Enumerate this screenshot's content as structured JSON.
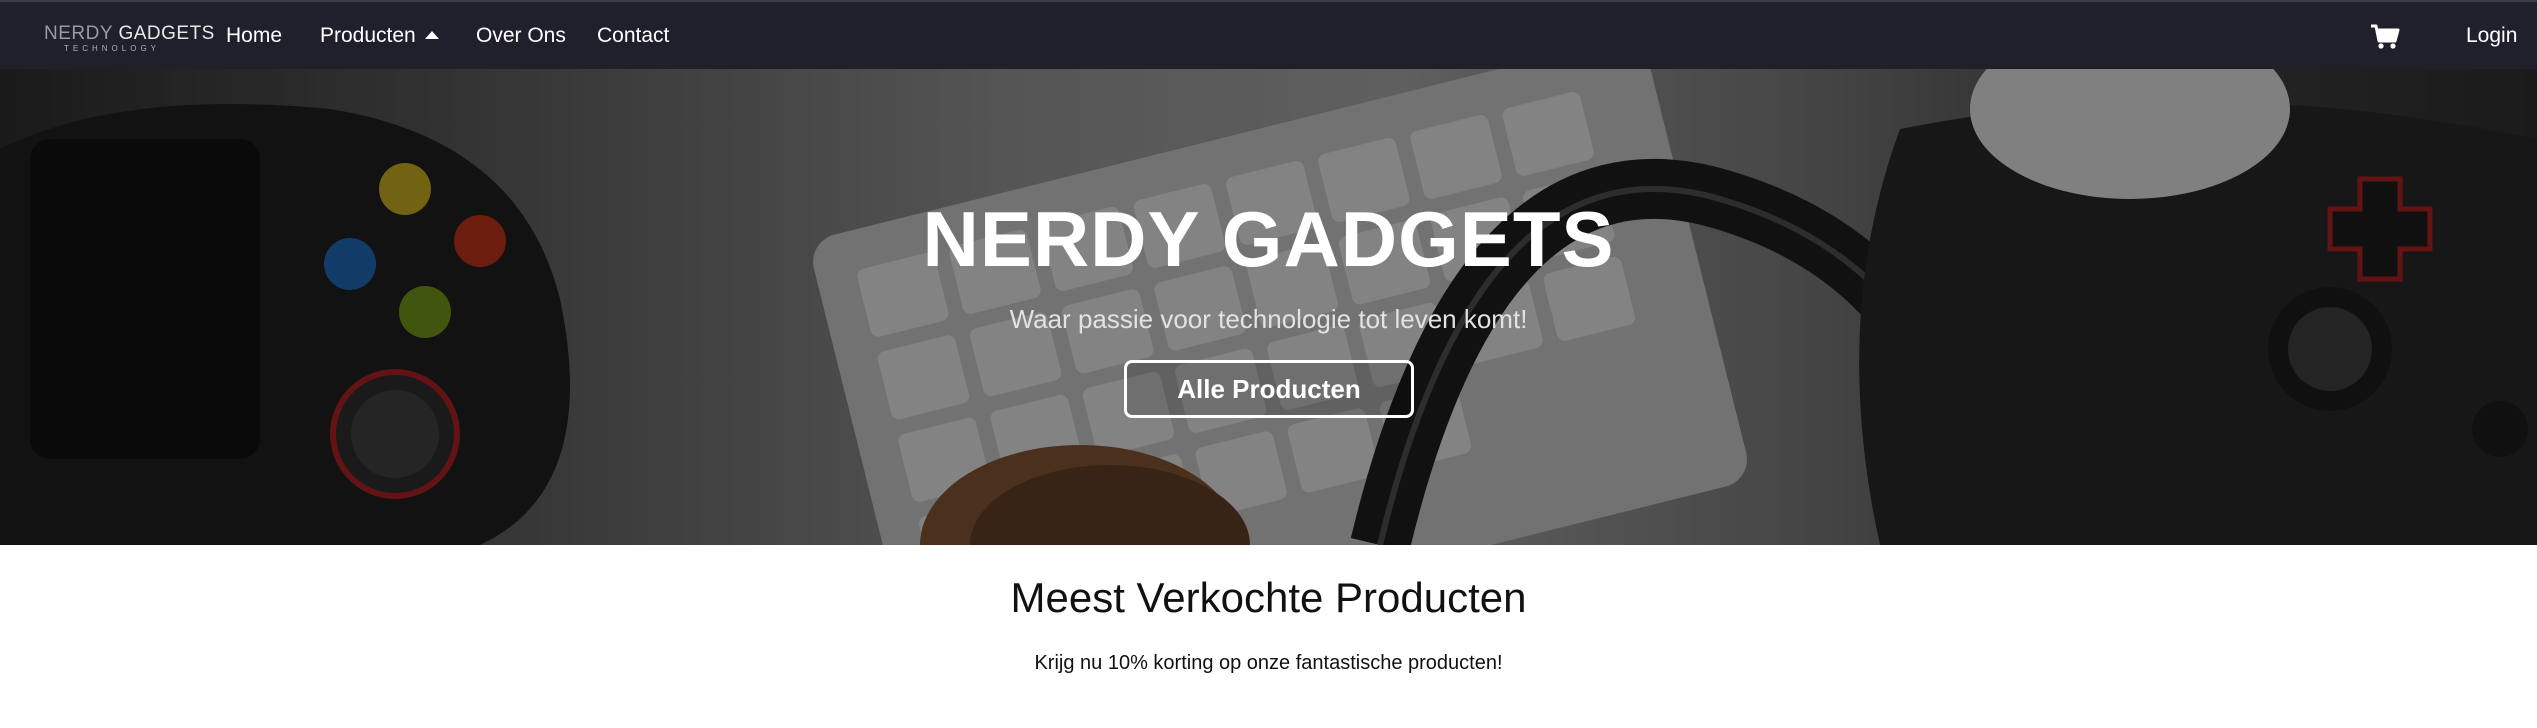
{
  "nav": {
    "logo_nerdy": "NERDY",
    "logo_gadgets": " GADGETS",
    "logo_tagline": "TECHNOLOGY",
    "items": [
      {
        "label": "Home"
      },
      {
        "label": "Producten"
      },
      {
        "label": "Over Ons"
      },
      {
        "label": "Contact"
      }
    ],
    "cart_icon": "shopping-cart-icon",
    "login_label": "Login"
  },
  "hero": {
    "title": "NERDY GADGETS",
    "subtitle": "Waar passie voor technologie tot leven komt!",
    "button_label": "Alle Producten"
  },
  "section": {
    "title": "Meest Verkochte Producten",
    "subtitle": "Krijg nu 10% korting op onze fantastische producten!"
  },
  "colors": {
    "navbar_bg": "#20202c",
    "text_on_dark": "#ffffff"
  }
}
